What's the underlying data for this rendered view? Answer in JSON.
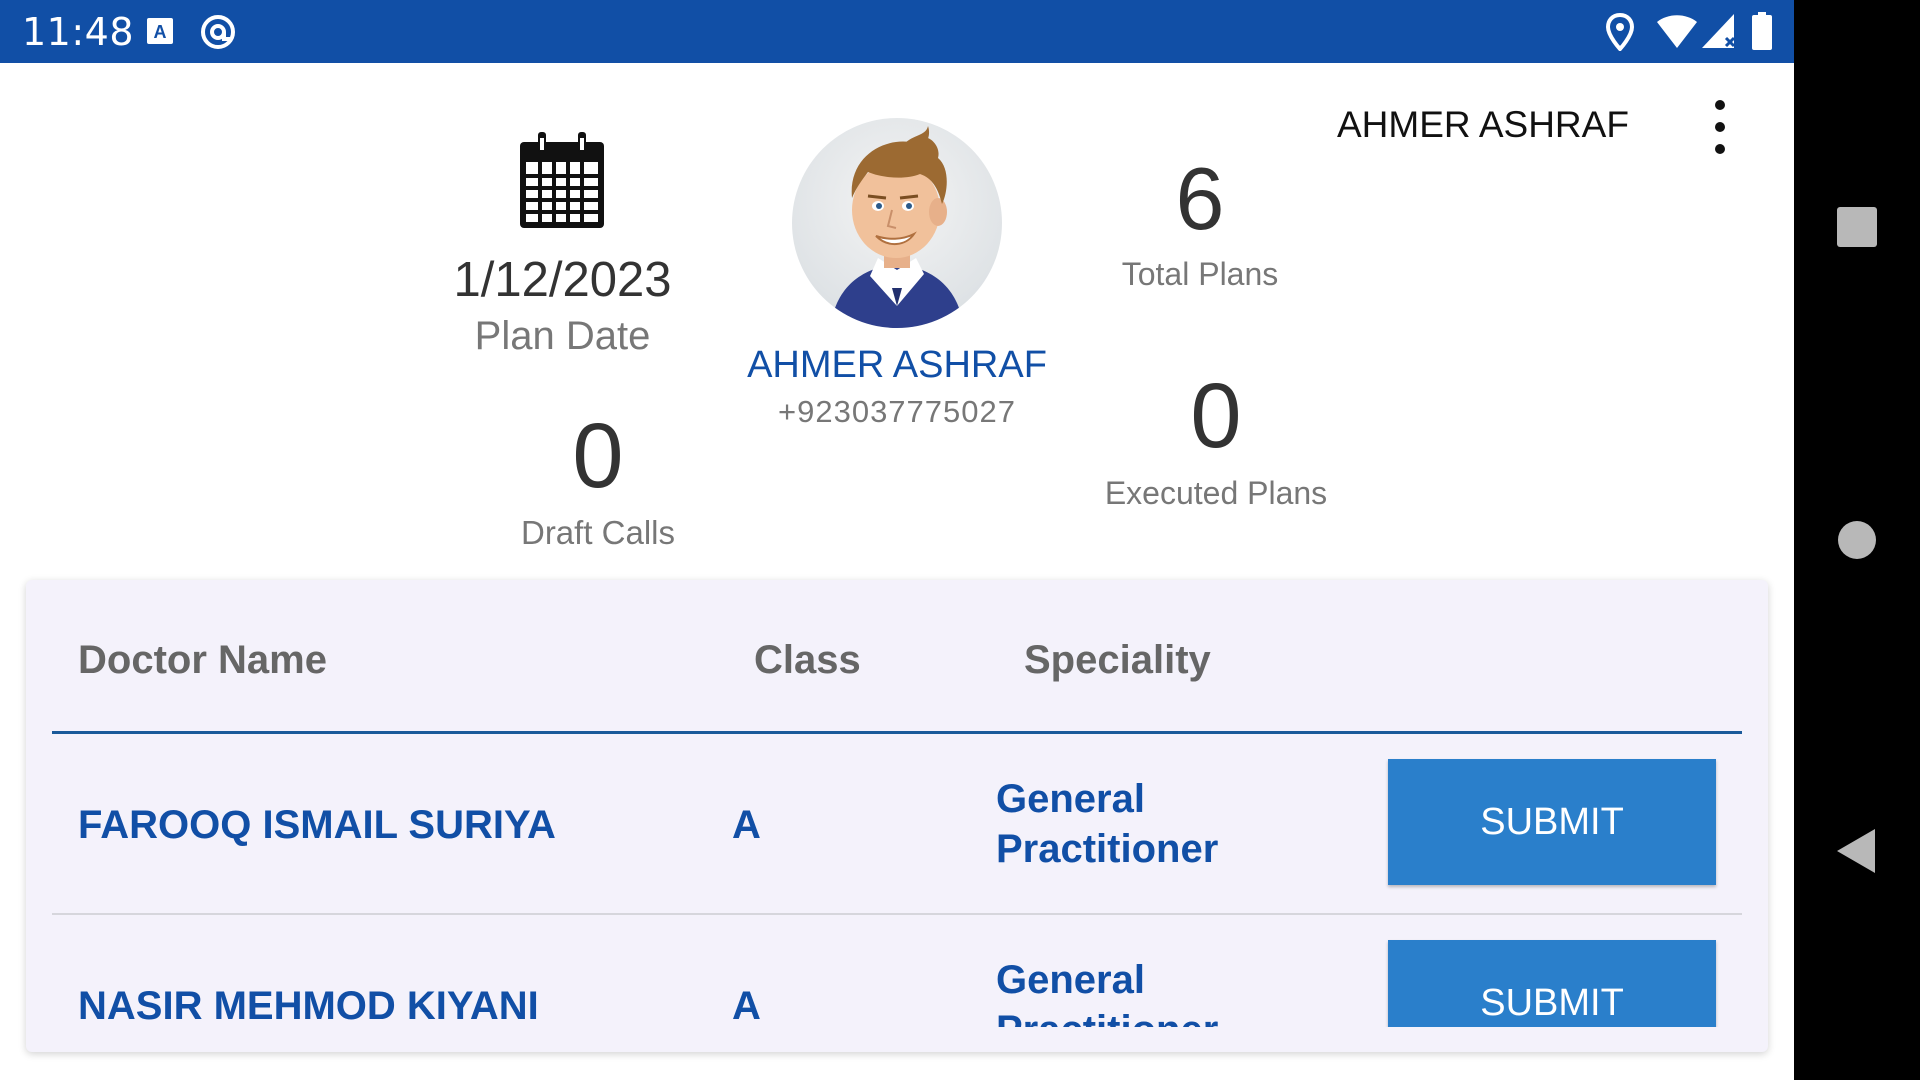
{
  "status_bar": {
    "time": "11:48",
    "icons_left": [
      "a-notification-icon",
      "at-sign-icon"
    ],
    "icons_right": [
      "location-icon",
      "wifi-icon",
      "signal-icon",
      "battery-icon"
    ]
  },
  "header": {
    "user_name": "AHMER ASHRAF",
    "menu_icon": "more-vert-icon"
  },
  "summary": {
    "calendar_icon": "calendar-icon",
    "plan_date": "1/12/2023",
    "plan_date_label": "Plan Date",
    "draft_calls": "0",
    "draft_calls_label": "Draft Calls",
    "profile_name": "AHMER ASHRAF",
    "profile_phone": "+923037775027",
    "total_plans": "6",
    "total_plans_label": "Total Plans",
    "executed_plans": "0",
    "executed_plans_label": "Executed Plans"
  },
  "table": {
    "headers": {
      "doctor_name": "Doctor Name",
      "class": "Class",
      "speciality": "Speciality"
    },
    "rows": [
      {
        "doctor_name": "FAROOQ ISMAIL SURIYA",
        "class": "A",
        "speciality": "General Practitioner",
        "action": "SUBMIT"
      },
      {
        "doctor_name": "NASIR MEHMOD KIYANI",
        "class": "A",
        "speciality": "General Practitioner",
        "action": "SUBMIT"
      }
    ]
  },
  "colors": {
    "status_bar": "#114fa6",
    "accent_text": "#114fa6",
    "submit_button": "#2a7fcb",
    "card_background": "#f4f2fb"
  },
  "nav_bar": {
    "buttons": [
      "recents-icon",
      "home-icon",
      "back-icon"
    ]
  }
}
